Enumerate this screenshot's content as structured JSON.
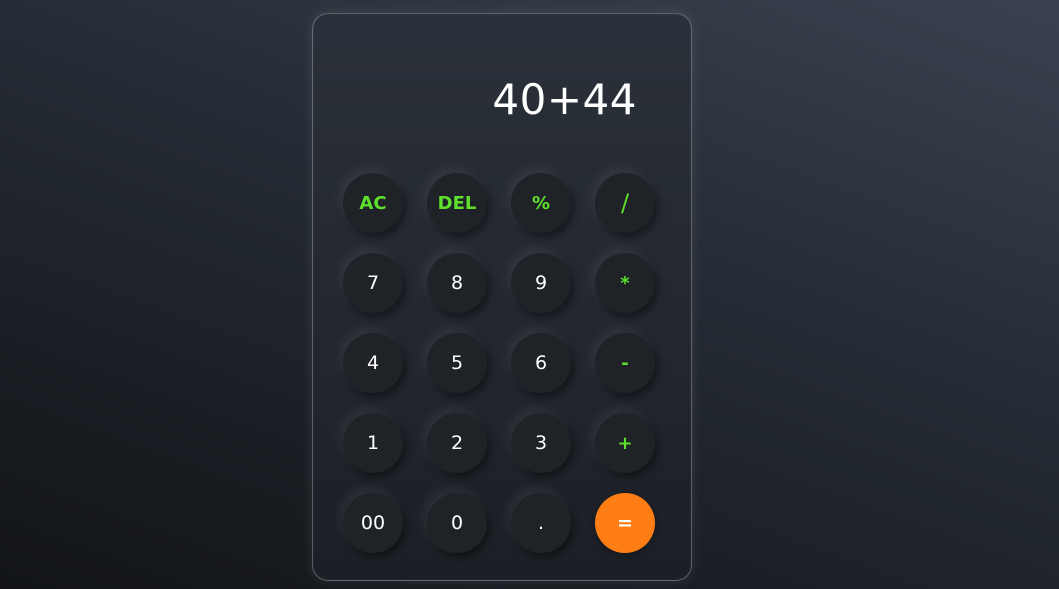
{
  "display": {
    "value": "40+44"
  },
  "keys": {
    "ac": "AC",
    "del": "DEL",
    "percent": "%",
    "divide": "/",
    "seven": "7",
    "eight": "8",
    "nine": "9",
    "multiply": "*",
    "four": "4",
    "five": "5",
    "six": "6",
    "minus": "-",
    "one": "1",
    "two": "2",
    "three": "3",
    "plus": "+",
    "double_zero": "00",
    "zero": "0",
    "dot": ".",
    "equals": "="
  },
  "colors": {
    "operator": "#5ee02d",
    "equals_bg": "#ff7d15",
    "key_bg": "#1f2328"
  }
}
